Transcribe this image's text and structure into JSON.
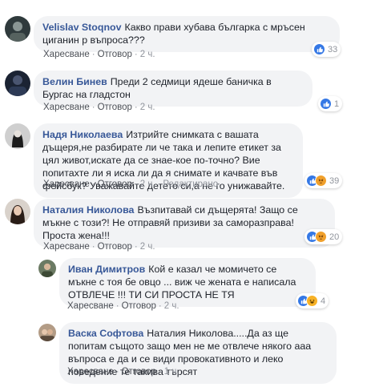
{
  "ui": {
    "like_label": "Харесване",
    "reply_label": "Отговор",
    "edited_label": "Редактирано",
    "sep": "·"
  },
  "comments": [
    {
      "author": "Velislav Stoqnov",
      "text": "Какво прави хубава българка с мръсен циганин р въпроса???",
      "time": "2 ч.",
      "reactions": [
        "like"
      ],
      "count": "33"
    },
    {
      "author": "Велин Бинев",
      "text": "Преди 2 седмици ядеше баничка в Бургас на гладстон",
      "time": "2 ч.",
      "reactions": [
        "like"
      ],
      "count": "1"
    },
    {
      "author": "Надя Николаева",
      "text": "Изтрийте снимката с вашата дъщеря,не разбирате ли че така и лепите етикет за цял живот,искате да се знае-кое по-точно? Вие попитахте ли я иска ли да я снимате и качвате във фейсбук? Уважавайте детето си,а не го унижавайте.",
      "time": "2 ч.",
      "edited": true,
      "reactions": [
        "like",
        "angry"
      ],
      "count": "39"
    },
    {
      "author": "Наталия Николова",
      "text": "Възпитавай си дъщерята! Защо се мъкне с този?! Не отправяй призиви за саморазправа! Проста жена!!!",
      "time": "2 ч.",
      "reactions": [
        "like",
        "angry"
      ],
      "count": "20"
    },
    {
      "author": "Иван Димитров",
      "text": "Кой е казал че момичето се мъкне с тоя бе овцо ... виж че жената е написала ОТВЛЕЧЕ !!! ТИ СИ ПРОСТА НЕ ТЯ",
      "time": "2 ч.",
      "reactions": [
        "like",
        "haha"
      ],
      "count": "4"
    },
    {
      "author": "Васка Софтова",
      "text": "Наталия Николова.....Да аз ще попитам същото защо мен не ме отвлече някого ааа въпроса е да и се види провокативното и леко поведение те такива търсят",
      "time": "1 ч.",
      "reactions": [],
      "count": ""
    }
  ]
}
